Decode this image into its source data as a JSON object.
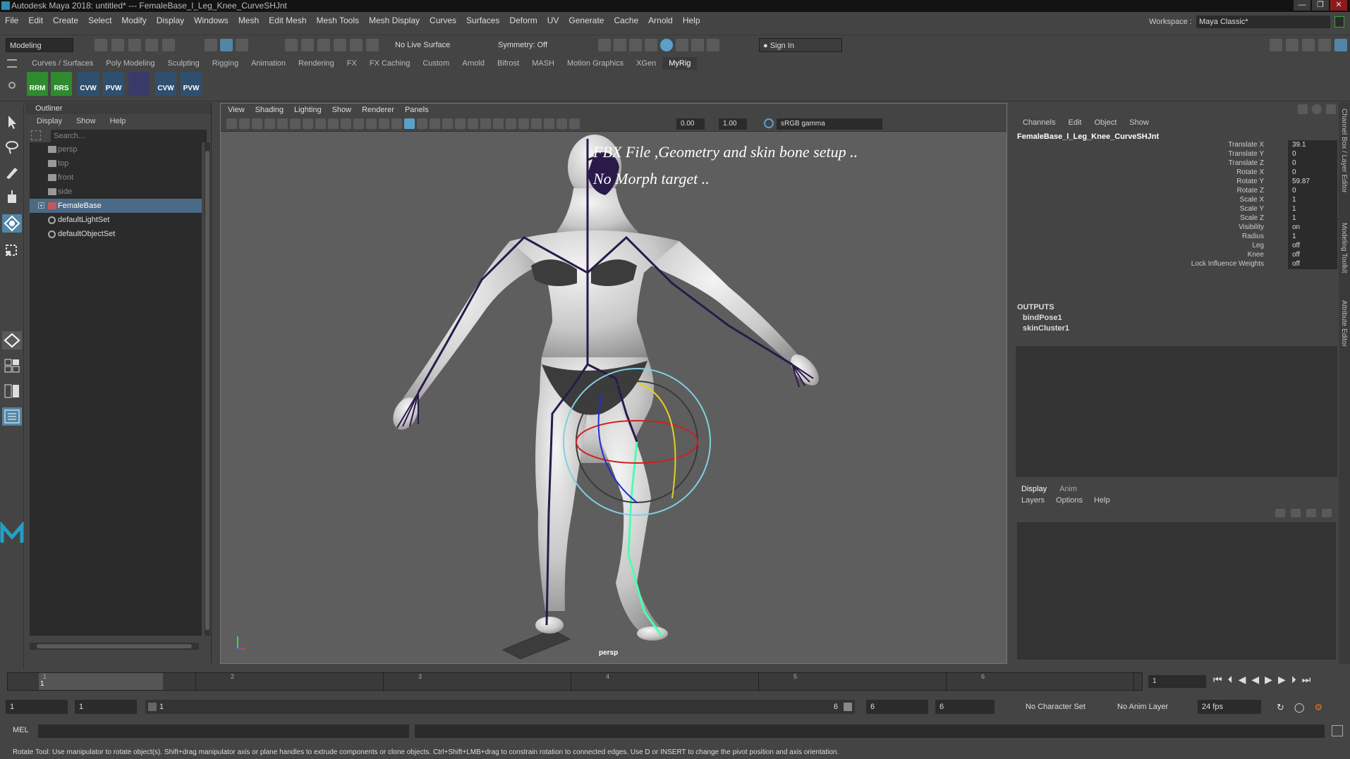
{
  "window": {
    "title": "Autodesk Maya 2018: untitled*   ---   FemaleBase_l_Leg_Knee_CurveSHJnt",
    "controls": [
      "—",
      "❐",
      "✕"
    ]
  },
  "menubar": [
    "File",
    "Edit",
    "Create",
    "Select",
    "Modify",
    "Display",
    "Windows",
    "Mesh",
    "Edit Mesh",
    "Mesh Tools",
    "Mesh Display",
    "Curves",
    "Surfaces",
    "Deform",
    "UV",
    "Generate",
    "Cache",
    "Arnold",
    "Help"
  ],
  "workspace": {
    "label": "Workspace :",
    "value": "Maya Classic*"
  },
  "statusline": {
    "mode": "Modeling",
    "live_surface": "No Live Surface",
    "symmetry": "Symmetry: Off",
    "sign_in": "Sign In"
  },
  "shelf": {
    "tabs": [
      "Curves / Surfaces",
      "Poly Modeling",
      "Sculpting",
      "Rigging",
      "Animation",
      "Rendering",
      "FX",
      "FX Caching",
      "Custom",
      "Arnold",
      "Bifrost",
      "MASH",
      "Motion Graphics",
      "XGen",
      "MyRig"
    ],
    "active_tab": "MyRig",
    "icons": [
      "RRM",
      "RRS",
      "CVW",
      "PVW",
      "",
      "CVW",
      "PVW"
    ]
  },
  "outliner": {
    "title": "Outliner",
    "menu": [
      "Display",
      "Show",
      "Help"
    ],
    "search_placeholder": "Search...",
    "items": [
      {
        "label": "persp",
        "type": "camera",
        "dim": true
      },
      {
        "label": "top",
        "type": "camera",
        "dim": true
      },
      {
        "label": "front",
        "type": "camera",
        "dim": true
      },
      {
        "label": "side",
        "type": "camera",
        "dim": true
      },
      {
        "label": "FemaleBase",
        "type": "joint",
        "selected": true
      },
      {
        "label": "defaultLightSet",
        "type": "set"
      },
      {
        "label": "defaultObjectSet",
        "type": "set"
      }
    ]
  },
  "viewport": {
    "menu": [
      "View",
      "Shading",
      "Lighting",
      "Show",
      "Renderer",
      "Panels"
    ],
    "exposure": "0.00",
    "gamma": "1.00",
    "color_space": "sRGB gamma",
    "overlay_line1": "FBX File ,Geometry and skin bone setup ..",
    "overlay_line2": "No Morph  target ..",
    "camera": "persp"
  },
  "channelbox": {
    "menu": [
      "Channels",
      "Edit",
      "Object",
      "Show"
    ],
    "node": "FemaleBase_l_Leg_Knee_CurveSHJnt",
    "attributes": [
      {
        "name": "Translate X",
        "value": "39.1"
      },
      {
        "name": "Translate Y",
        "value": "0"
      },
      {
        "name": "Translate Z",
        "value": "0"
      },
      {
        "name": "Rotate X",
        "value": "0"
      },
      {
        "name": "Rotate Y",
        "value": "59.87"
      },
      {
        "name": "Rotate Z",
        "value": "0"
      },
      {
        "name": "Scale X",
        "value": "1"
      },
      {
        "name": "Scale Y",
        "value": "1"
      },
      {
        "name": "Scale Z",
        "value": "1"
      },
      {
        "name": "Visibility",
        "value": "on"
      },
      {
        "name": "Radius",
        "value": "1"
      },
      {
        "name": "Leg",
        "value": "off"
      },
      {
        "name": "Knee",
        "value": "off"
      },
      {
        "name": "Lock Influence Weights",
        "value": "off"
      }
    ],
    "outputs_header": "OUTPUTS",
    "outputs": [
      "bindPose1",
      "skinCluster1"
    ]
  },
  "layer_editor": {
    "tabs": [
      "Display",
      "Anim"
    ],
    "active_tab": "Display",
    "menu": [
      "Layers",
      "Options",
      "Help"
    ]
  },
  "side_tabs": [
    "Channel Box / Layer Editor",
    "Modeling Toolkit",
    "Attribute Editor"
  ],
  "timeslider": {
    "ticks": [
      "1",
      "2",
      "3",
      "4",
      "5",
      "6"
    ],
    "playhead": "1",
    "current_frame": "1"
  },
  "range": {
    "start": "1",
    "anim_start": "1",
    "range_start_label": "1",
    "range_end_label": "6",
    "end": "6",
    "anim_end": "6",
    "character_set": "No Character Set",
    "anim_layer": "No Anim Layer",
    "fps": "24 fps"
  },
  "cmdline": {
    "label": "MEL"
  },
  "helpline": "Rotate Tool: Use manipulator to rotate object(s). Shift+drag manipulator axis or plane handles to extrude components or clone objects. Ctrl+Shift+LMB+drag to constrain rotation to connected edges. Use D or INSERT to change the pivot position and axis orientation.",
  "colors": {
    "accent": "#5285a6",
    "selection": "#4b6a86",
    "joint": "#2a1a4a",
    "joint_selected": "#4dffb0",
    "manip_x": "#d02020",
    "manip_y": "#e0d020",
    "manip_z": "#2030d0",
    "manip_outer": "#80d0e0"
  }
}
